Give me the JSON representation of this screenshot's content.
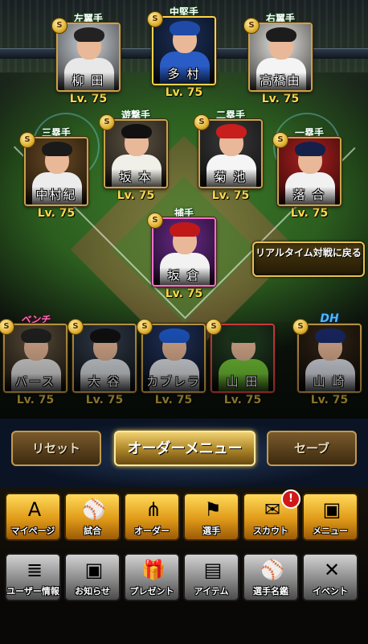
{
  "lineup": {
    "outfield": [
      {
        "position": "左翼手",
        "name": "柳 田",
        "level": "Lv. 75",
        "badge": "S",
        "palette": {
          "bg": "#cfd4da",
          "cap": "#222",
          "body": "#e8e8e8",
          "border": "#c9a24a"
        }
      },
      {
        "position": "中堅手",
        "name": "多 村",
        "level": "Lv. 75",
        "badge": "S",
        "palette": {
          "bg": "#1b2f57",
          "cap": "#1f4aa8",
          "body": "#2a5cc6",
          "border": "#ffd34a"
        }
      },
      {
        "position": "右翼手",
        "name": "高橋由",
        "level": "Lv. 75",
        "badge": "S",
        "palette": {
          "bg": "#e9e7e2",
          "cap": "#1c1c1c",
          "body": "#f4f4f4",
          "border": "#c9a24a"
        }
      }
    ],
    "infield_upper": [
      {
        "position": "遊撃手",
        "name": "坂 本",
        "level": "Lv. 75",
        "badge": "S",
        "palette": {
          "bg": "#5e5343",
          "cap": "#111",
          "body": "#f0efe8",
          "border": "#c9a24a"
        }
      },
      {
        "position": "二塁手",
        "name": "菊 池",
        "level": "Lv. 75",
        "badge": "S",
        "palette": {
          "bg": "#3a3a3a",
          "cap": "#c81e1e",
          "body": "#f5f5f5",
          "border": "#c9a24a"
        }
      }
    ],
    "infield_lower": [
      {
        "position": "三塁手",
        "name": "中村紀",
        "level": "Lv. 75",
        "badge": "S",
        "palette": {
          "bg": "#6a4a24",
          "cap": "#1a1a1a",
          "body": "#ececec",
          "border": "#c9a24a"
        }
      },
      {
        "position": "一塁手",
        "name": "落 合",
        "level": "Lv. 75",
        "badge": "S",
        "palette": {
          "bg": "#b02020",
          "cap": "#14204a",
          "body": "#f1f1f1",
          "border": "#c9a24a"
        }
      }
    ],
    "catcher": {
      "position": "捕手",
      "name": "坂 倉",
      "level": "Lv. 75",
      "badge": "S",
      "palette": {
        "bg": "#6a2a8a",
        "cap": "#c01818",
        "body": "#f2f2f2",
        "border": "#ff6ecf"
      }
    }
  },
  "realtime_button": {
    "label": "リアルタイム対戦に戻る"
  },
  "bench": {
    "bench_label": "ベンチ",
    "dh_label": "DH",
    "players": [
      {
        "name": "バース",
        "level": "Lv. 75",
        "badge": "S",
        "palette": {
          "bg": "#6a5a44",
          "cap": "#222",
          "body": "#f0f0f0",
          "border": "#c9a24a"
        }
      },
      {
        "name": "大 谷",
        "level": "Lv. 75",
        "badge": "S",
        "palette": {
          "bg": "#3a4656",
          "cap": "#111",
          "body": "#e8ecf0",
          "border": "#c9a24a"
        }
      },
      {
        "name": "カブレラ",
        "level": "Lv. 75",
        "badge": "S",
        "palette": {
          "bg": "#263a6a",
          "cap": "#1f5acc",
          "body": "#f0f3f8",
          "border": "#c9a24a"
        }
      },
      {
        "name": "山 田",
        "level": "Lv. 75",
        "badge": "S",
        "palette": {
          "bg": "#2a4a2a",
          "cap": "#1a3a1a",
          "body": "#7ad23a",
          "border": "#e04040"
        }
      },
      {
        "name": "山 崎",
        "level": "Lv. 75",
        "badge": "S",
        "palette": {
          "bg": "#3a2a1a",
          "cap": "#1a2a6a",
          "body": "#e8ecf4",
          "border": "#c9a24a"
        }
      }
    ]
  },
  "order_buttons": {
    "reset": "リセット",
    "order_menu": "オーダーメニュー",
    "save": "セーブ"
  },
  "menu_row1": [
    {
      "label": "マイページ",
      "icon": "mypage-icon",
      "glyph": "A"
    },
    {
      "label": "試合",
      "icon": "stadium-icon",
      "glyph": "⚾"
    },
    {
      "label": "オーダー",
      "icon": "order-icon",
      "glyph": "⋔"
    },
    {
      "label": "選手",
      "icon": "player-icon",
      "glyph": "⚑"
    },
    {
      "label": "スカウト",
      "icon": "scout-icon",
      "glyph": "✉",
      "alert": "!"
    },
    {
      "label": "メニュー",
      "icon": "menu-icon",
      "glyph": "▣"
    }
  ],
  "menu_row2": [
    {
      "label": "ユーザー情報",
      "icon": "user-info-icon",
      "glyph": "≣"
    },
    {
      "label": "お知らせ",
      "icon": "notice-icon",
      "glyph": "▣"
    },
    {
      "label": "プレゼント",
      "icon": "present-icon",
      "glyph": "🎁"
    },
    {
      "label": "アイテム",
      "icon": "item-icon",
      "glyph": "▤"
    },
    {
      "label": "選手名鑑",
      "icon": "player-book-icon",
      "glyph": "⚾"
    },
    {
      "label": "イベント",
      "icon": "event-icon",
      "glyph": "✕"
    }
  ]
}
